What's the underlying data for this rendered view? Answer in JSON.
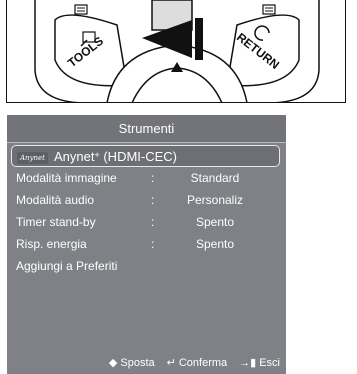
{
  "remote": {
    "tools_label": "TOOLS",
    "return_label": "RETURN",
    "center_button_label": "III",
    "icons": [
      "tools-icon",
      "return-icon",
      "up-arrow-icon",
      "left-arrow-icon"
    ]
  },
  "menu": {
    "title": "Strumenti",
    "selected_item": {
      "logo_text": "Anynet",
      "label": "Anynet",
      "sup": "+",
      "suffix": " (HDMI-CEC)"
    },
    "items": [
      {
        "label": "Modalità immagine",
        "colon": ":",
        "value": "Standard"
      },
      {
        "label": "Modalità audio",
        "colon": ":",
        "value": "Personaliz"
      },
      {
        "label": "Timer stand-by",
        "colon": ":",
        "value": "Spento"
      },
      {
        "label": "Risp. energia",
        "colon": ":",
        "value": "Spento"
      },
      {
        "label": "Aggiungi a Preferiti",
        "colon": "",
        "value": ""
      }
    ],
    "footer": {
      "move_label": "Sposta",
      "confirm_label": "Conferma",
      "exit_label": "Esci"
    }
  },
  "colors": {
    "menu_bg": "#7f8186",
    "title_bg": "#727479",
    "text": "#ffffff"
  }
}
